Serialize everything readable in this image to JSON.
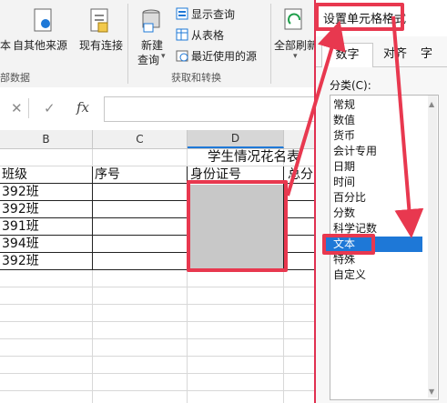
{
  "ribbon": {
    "btn_other_sources_prefix": "本",
    "btn_other_sources": "自其他来源",
    "btn_existing_connections": "现有连接",
    "btn_new_query_line1": "新建",
    "btn_new_query_line2": "查询",
    "btn_show_queries": "显示查询",
    "btn_from_table": "从表格",
    "btn_recent_sources": "最近使用的源",
    "btn_refresh_all": "全部刷新",
    "group_external_data": "部数据",
    "group_get_transform": "获取和转换"
  },
  "formula_bar": {
    "cancel_glyph": "✕",
    "enter_glyph": "✓",
    "fx_glyph": "fx",
    "value": ""
  },
  "sheet": {
    "columns": [
      "B",
      "C",
      "D"
    ],
    "title": "学生情况花名表",
    "headers": [
      "班级",
      "序号",
      "身份证号",
      "总分"
    ],
    "rows": [
      [
        "392班",
        "",
        ""
      ],
      [
        "392班",
        "",
        ""
      ],
      [
        "391班",
        "",
        ""
      ],
      [
        "394班",
        "",
        ""
      ],
      [
        "392班",
        "",
        ""
      ]
    ]
  },
  "dialog": {
    "title": "设置单元格格式",
    "tabs": [
      "数字",
      "对齐",
      "字体"
    ],
    "tab_last_visible": "字",
    "category_label": "分类(C):",
    "categories": [
      "常规",
      "数值",
      "货币",
      "会计专用",
      "日期",
      "时间",
      "百分比",
      "分数",
      "科学记数",
      "文本",
      "特殊",
      "自定义"
    ],
    "selected_category": "文本"
  },
  "colors": {
    "annotation_red": "#e8384f",
    "selection_blue": "#1e78d7",
    "selected_fill": "#c8c8c8"
  }
}
